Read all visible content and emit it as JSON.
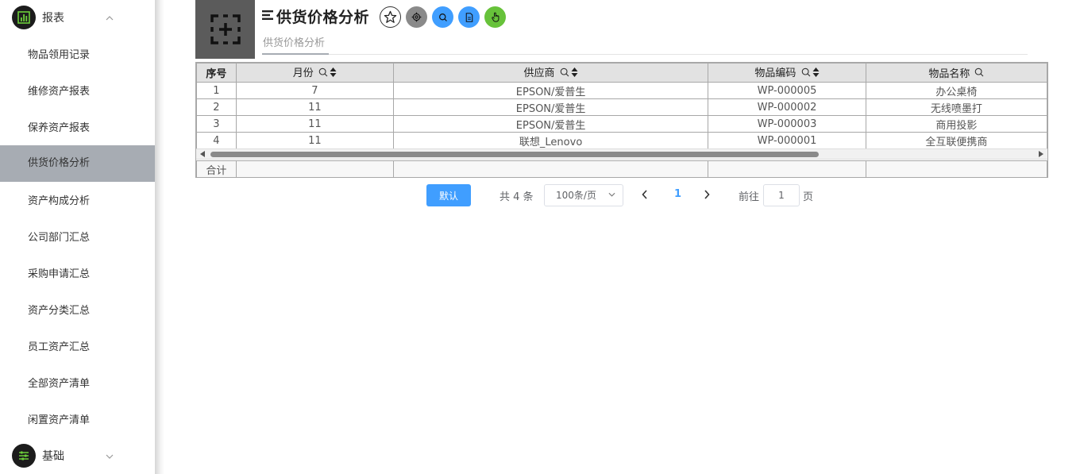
{
  "sidebar": {
    "groups": [
      {
        "label": "报表",
        "icon": "bar-chart-icon",
        "expanded": true
      },
      {
        "label": "基础",
        "icon": "sliders-icon",
        "expanded": false
      }
    ],
    "items": [
      {
        "label": "物品领用记录"
      },
      {
        "label": "维修资产报表"
      },
      {
        "label": "保养资产报表"
      },
      {
        "label": "供货价格分析",
        "active": true
      },
      {
        "label": "资产构成分析"
      },
      {
        "label": "公司部门汇总"
      },
      {
        "label": "采购申请汇总"
      },
      {
        "label": "资产分类汇总"
      },
      {
        "label": "员工资产汇总"
      },
      {
        "label": "全部资产清单"
      },
      {
        "label": "闲置资产清单"
      }
    ]
  },
  "header": {
    "title": "供货价格分析",
    "tab_label": "供货价格分析",
    "buttons": [
      {
        "name": "star-button",
        "icon": "star-icon",
        "color": "#ffffff"
      },
      {
        "name": "settings-button",
        "icon": "gear-icon",
        "color": "#8a8a8a"
      },
      {
        "name": "search-button",
        "icon": "search-icon",
        "color": "#409eff"
      },
      {
        "name": "document-button",
        "icon": "document-icon",
        "color": "#409eff"
      },
      {
        "name": "hand-button",
        "icon": "hand-icon",
        "color": "#67c23a"
      }
    ]
  },
  "table": {
    "columns": [
      "序号",
      "月份",
      "供应商",
      "物品编码",
      "物品名称"
    ],
    "rows": [
      [
        "1",
        "7",
        "EPSON/爱普生",
        "WP-000005",
        "办公桌椅"
      ],
      [
        "2",
        "11",
        "EPSON/爱普生",
        "WP-000002",
        "无线喷墨打"
      ],
      [
        "3",
        "11",
        "EPSON/爱普生",
        "WP-000003",
        "商用投影"
      ],
      [
        "4",
        "11",
        "联想_Lenovo",
        "WP-000001",
        "全互联便携商"
      ]
    ],
    "sum_label": "合计"
  },
  "pagination": {
    "default_button": "默认",
    "total": "共 4 条",
    "page_size": "100条/页",
    "current_page": "1",
    "goto_label": "前往",
    "goto_value": "1",
    "goto_suffix": "页"
  },
  "colors": {
    "accent": "#409eff",
    "sidebar_active": "#a7acb3",
    "header_box": "#5b5b5b"
  }
}
